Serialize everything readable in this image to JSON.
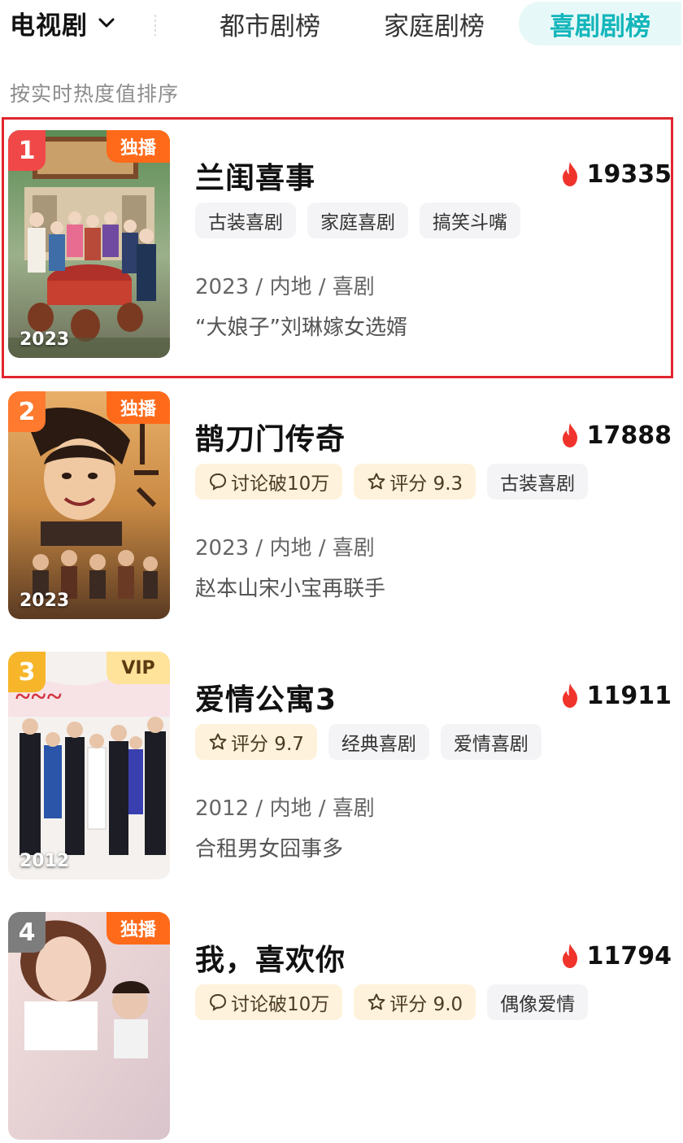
{
  "header": {
    "category": "电视剧",
    "tabs": [
      {
        "label": "都市剧榜",
        "active": false
      },
      {
        "label": "家庭剧榜",
        "active": false
      },
      {
        "label": "喜剧剧榜",
        "active": true
      }
    ],
    "sort_note": "按实时热度值排序"
  },
  "colors": {
    "accent_teal": "#13b6bb",
    "selection_red": "#e0262e",
    "exclusive_orange": "#ff6a1a",
    "flame_red": "#f0342c"
  },
  "items": [
    {
      "rank": "1",
      "rank_color": "#f04848",
      "badge": "独播",
      "badge_type": "excl",
      "poster_year": "2023",
      "title": "兰闺喜事",
      "heat": "19335",
      "tags": [
        {
          "icon": "",
          "label": "古装喜剧",
          "style": "plain"
        },
        {
          "icon": "",
          "label": "家庭喜剧",
          "style": "plain"
        },
        {
          "icon": "",
          "label": "搞笑斗嘴",
          "style": "plain"
        }
      ],
      "meta": "2023 / 内地 / 喜剧",
      "desc": "“大娘子”刘琳嫁女选婿",
      "selected": true
    },
    {
      "rank": "2",
      "rank_color": "#ff7a2e",
      "badge": "独播",
      "badge_type": "excl",
      "poster_year": "2023",
      "title": "鹊刀门传奇",
      "heat": "17888",
      "tags": [
        {
          "icon": "chat-bubble-icon",
          "label": "讨论破10万",
          "style": "gold"
        },
        {
          "icon": "star-icon",
          "label": "评分 9.3",
          "style": "gold"
        },
        {
          "icon": "",
          "label": "古装喜剧",
          "style": "plain"
        }
      ],
      "meta": "2023 / 内地 / 喜剧",
      "desc": "赵本山宋小宝再联手",
      "selected": false
    },
    {
      "rank": "3",
      "rank_color": "#f7b52a",
      "badge": "VIP",
      "badge_type": "vip",
      "poster_year": "2012",
      "title": "爱情公寓3",
      "heat": "11911",
      "tags": [
        {
          "icon": "star-icon",
          "label": "评分 9.7",
          "style": "gold"
        },
        {
          "icon": "",
          "label": "经典喜剧",
          "style": "plain"
        },
        {
          "icon": "",
          "label": "爱情喜剧",
          "style": "plain"
        }
      ],
      "meta": "2012 / 内地 / 喜剧",
      "desc": "合租男女囧事多",
      "selected": false
    },
    {
      "rank": "4",
      "rank_color": "#7d7d7d",
      "badge": "独播",
      "badge_type": "excl",
      "poster_year": "",
      "title": "我，喜欢你",
      "heat": "11794",
      "tags": [
        {
          "icon": "chat-bubble-icon",
          "label": "讨论破10万",
          "style": "gold"
        },
        {
          "icon": "star-icon",
          "label": "评分 9.0",
          "style": "gold"
        },
        {
          "icon": "",
          "label": "偶像爱情",
          "style": "plain"
        }
      ],
      "meta": "",
      "desc": "",
      "selected": false
    }
  ]
}
